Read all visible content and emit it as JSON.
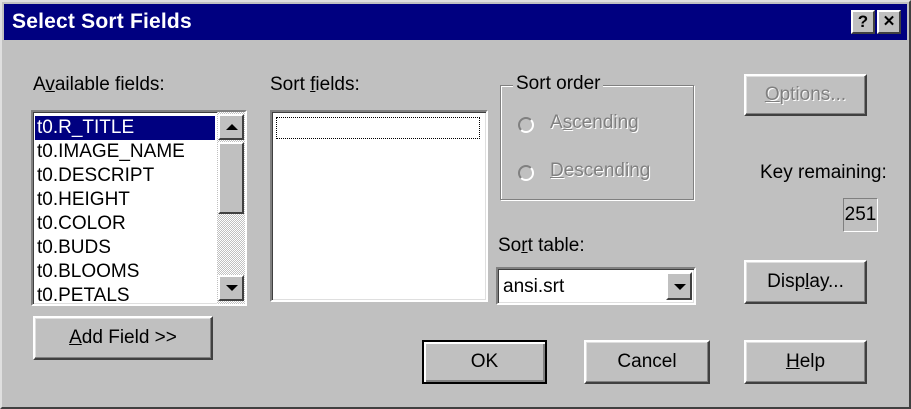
{
  "window": {
    "title": "Select Sort Fields",
    "help_button": "?",
    "close_button": "✕"
  },
  "available": {
    "label_pre": "A",
    "label_accel": "v",
    "label_post": "ailable fields:",
    "items": [
      "t0.R_TITLE",
      "t0.IMAGE_NAME",
      "t0.DESCRIPT",
      "t0.HEIGHT",
      "t0.COLOR",
      "t0.BUDS",
      "t0.BLOOMS",
      "t0.PETALS"
    ],
    "selected_index": 0
  },
  "sort_fields": {
    "label_pre": "Sort ",
    "label_accel": "f",
    "label_post": "ields:"
  },
  "sort_order": {
    "label": "Sort order",
    "ascending_pre": "A",
    "ascending_accel": "s",
    "ascending_post": "cending",
    "descending_pre": "",
    "descending_accel": "D",
    "descending_post": "escending"
  },
  "sort_table": {
    "label_pre": "So",
    "label_accel": "r",
    "label_post": "t table:",
    "value": "ansi.srt"
  },
  "options_button": {
    "pre": "",
    "accel": "O",
    "post": "ptions..."
  },
  "key_remaining": {
    "label": "Key remaining:",
    "value": "251"
  },
  "display_button": {
    "pre": "Disp",
    "accel": "l",
    "post": "ay..."
  },
  "add_field_button": {
    "pre": "",
    "accel": "A",
    "post": "dd Field >>"
  },
  "ok_button": "OK",
  "cancel_button": "Cancel",
  "help_button": {
    "pre": "",
    "accel": "H",
    "post": "elp"
  }
}
